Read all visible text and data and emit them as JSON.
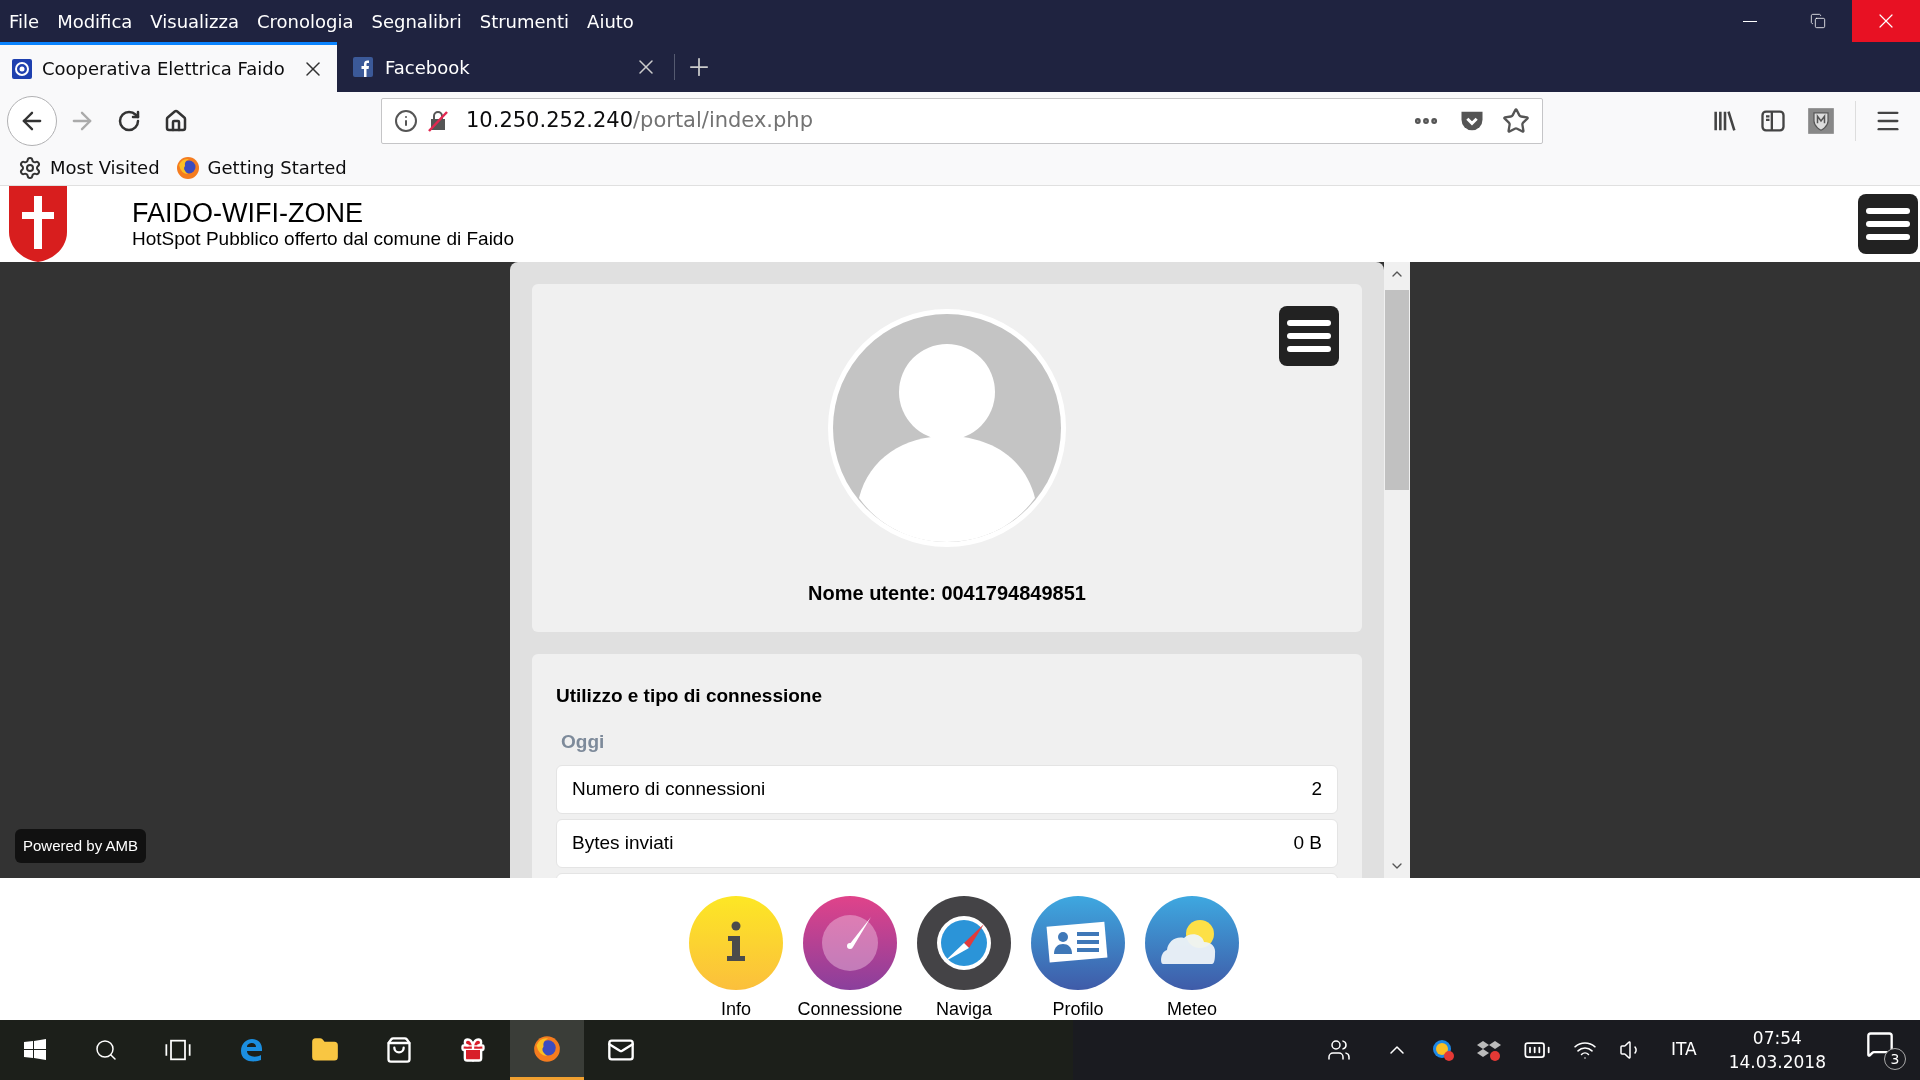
{
  "menu_bar": [
    "File",
    "Modifica",
    "Visualizza",
    "Cronologia",
    "Segnalibri",
    "Strumenti",
    "Aiuto"
  ],
  "tabs": [
    {
      "title": "Cooperativa Elettrica Faido",
      "kind": "site",
      "selected": true
    },
    {
      "title": "Facebook",
      "kind": "facebook",
      "selected": false
    }
  ],
  "address_bar": {
    "host": "10.250.252.240",
    "path": "/portal/index.php"
  },
  "bookmarks": [
    {
      "label": "Most Visited",
      "kind": "gear"
    },
    {
      "label": "Getting Started",
      "kind": "firefox"
    }
  ],
  "site_header": {
    "title": "FAIDO-WIFI-ZONE",
    "subtitle": "HotSpot Pubblico offerto dal comune di Faido"
  },
  "profile": {
    "username_label": "Nome utente:",
    "username": "0041794849851"
  },
  "usage": {
    "title": "Utilizzo e tipo di connessione",
    "section": "Oggi",
    "rows": [
      {
        "label": "Numero di connessioni",
        "value": "2"
      },
      {
        "label": "Bytes inviati",
        "value": "0 B"
      }
    ]
  },
  "powered_by": "Powered by AMB",
  "dock": [
    {
      "label": "Info",
      "kind": "info"
    },
    {
      "label": "Connessione",
      "kind": "gauge"
    },
    {
      "label": "Naviga",
      "kind": "compass"
    },
    {
      "label": "Profilo",
      "kind": "card"
    },
    {
      "label": "Meteo",
      "kind": "weather"
    }
  ],
  "taskbar": {
    "language": "ITA",
    "time": "07:54",
    "date": "14.03.2018",
    "notifications": "3",
    "apps": [
      {
        "kind": "edge",
        "active": false
      },
      {
        "kind": "explorer",
        "active": false
      },
      {
        "kind": "store",
        "active": false
      },
      {
        "kind": "gift",
        "active": false
      },
      {
        "kind": "firefox",
        "active": true
      },
      {
        "kind": "mail",
        "active": false
      }
    ]
  }
}
